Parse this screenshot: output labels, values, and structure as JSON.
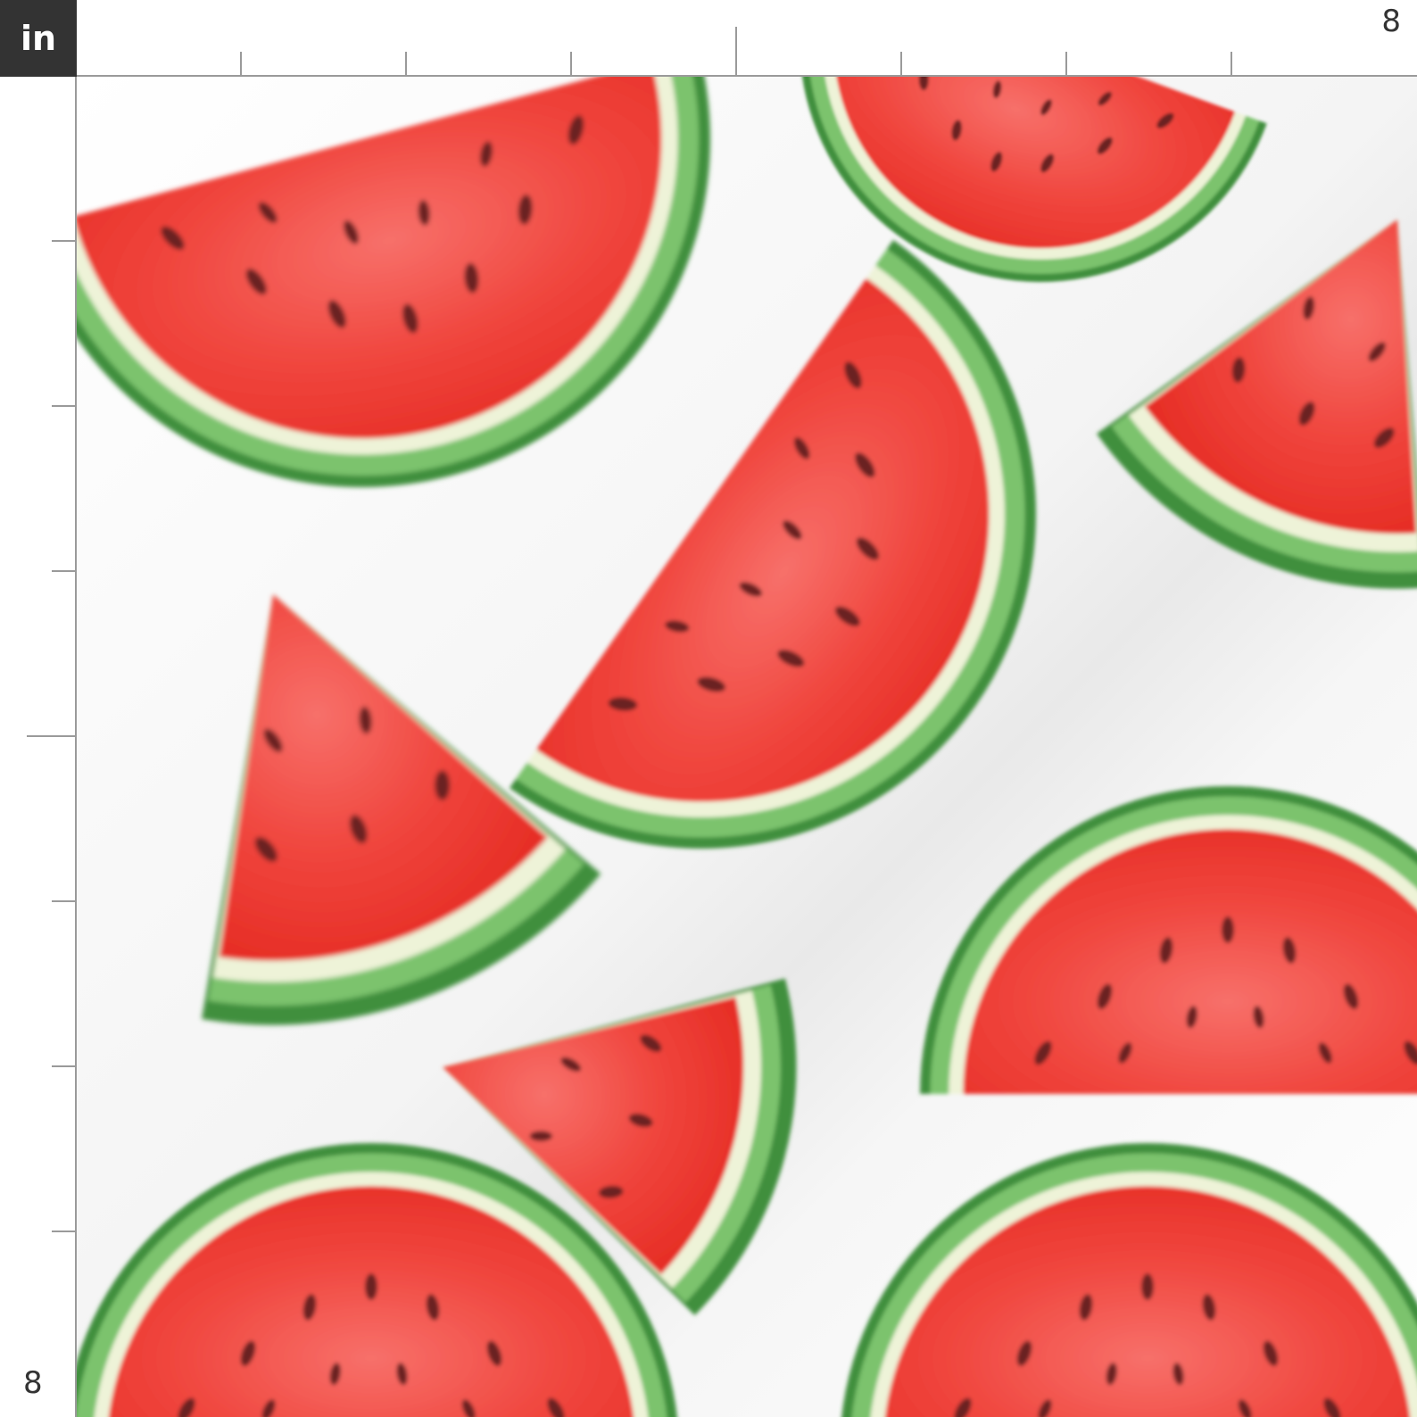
{
  "ruler": {
    "unit_label": "in",
    "top_end_label": "8",
    "left_end_label": "8"
  },
  "design": {
    "motif": "watercolor-watermelon-slices",
    "colors": {
      "flesh": "#f0403a",
      "flesh_light": "#f7665e",
      "flesh_deep": "#e22a22",
      "rind_inner": "#eef3d8",
      "rind_green": "#7cc36d",
      "rind_dark": "#3f8f3c",
      "seed": "#6b2420",
      "background": "#ffffff",
      "ruler_line": "#9a9a9a",
      "badge": "#333333"
    }
  }
}
